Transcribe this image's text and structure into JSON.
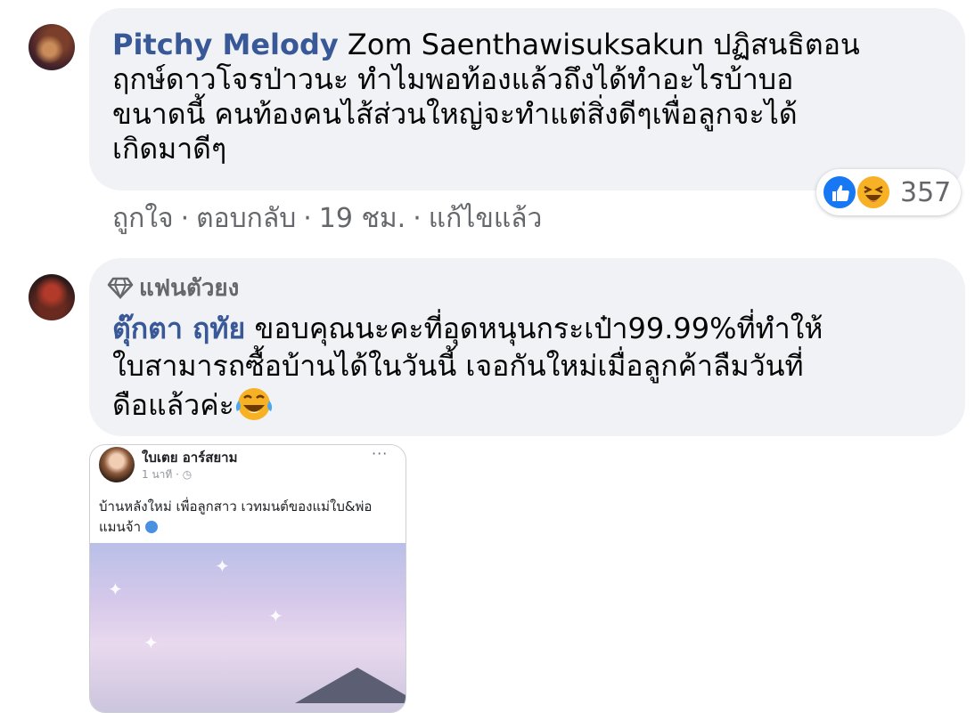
{
  "comments": [
    {
      "author": "Pitchy Melody",
      "text_lines": [
        "Zom Saenthawisuksakun ปฏิสนธิตอน",
        "ฤกษ์ดาวโจรป่าวนะ ทำไมพอท้องแล้วถึงได้ทำอะไรบ้าบอ",
        "ขนาดนี้ คนท้องคนไส้ส่วนใหญ่จะทำแต่สิ่งดีๆเพื่อลูกจะได้",
        "เกิดมาดีๆ"
      ],
      "reaction_count": "357",
      "reaction_icons": [
        "like-icon",
        "haha-icon"
      ],
      "actions": {
        "like": "ถูกใจ",
        "reply": "ตอบกลับ",
        "time": "19 ชม.",
        "edited": "แก้ไขแล้ว",
        "separator": "·"
      }
    },
    {
      "badge": "แฟนตัวยง",
      "badge_icon": "diamond-icon",
      "author": "ตุ๊กตา ฤทัย",
      "text_lines": [
        "ขอบคุณนะคะที่อุดหนุนกระเป๋า99.99%ที่ทำให้",
        "ใบสามารถซื้อบ้านได้ในวันนี้ เจอกันใหม่เมื่อลูกค้าลืมวันที่",
        "ดือแล้วค่ะ"
      ],
      "trailing_emoji": "tears-of-joy-emoji"
    }
  ],
  "attachment": {
    "name": "ใบเตย อาร์สยาม",
    "meta": "1 นาที · ◷",
    "more": "···",
    "text_lines": [
      "บ้านหลังใหม่ เพื่อลูกสาว เวทมนต์ของแม่ใบ&พ่อ",
      "แมนจ้า"
    ]
  },
  "colors": {
    "author": "#385898",
    "bubble": "#f0f2f5",
    "meta": "#65676b",
    "like": "#1877f2",
    "haha": "#f7b125"
  }
}
